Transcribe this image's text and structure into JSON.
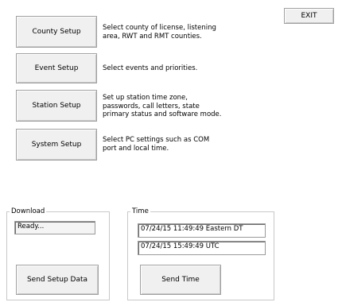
{
  "toolbar": {
    "exit_label": "EXIT"
  },
  "setup_items": [
    {
      "button": "County Setup",
      "description": [
        "Select county of license, listening",
        "area, RWT and RMT counties."
      ]
    },
    {
      "button": "Event Setup",
      "description": [
        "Select events and priorities."
      ]
    },
    {
      "button": "Station Setup",
      "description": [
        "Set up station time zone,",
        "passwords, call letters, state",
        "primary status and software mode."
      ]
    },
    {
      "button": "System Setup",
      "description": [
        "Select PC settings such as COM",
        "port and local time."
      ]
    }
  ],
  "download": {
    "group_label": "Download",
    "status": "Ready...",
    "send_button": "Send Setup Data"
  },
  "time": {
    "group_label": "Time",
    "local_time": "07/24/15 11:49:49  Eastern DT",
    "utc_time": "07/24/15 15:49:49  UTC",
    "send_button": "Send Time"
  }
}
